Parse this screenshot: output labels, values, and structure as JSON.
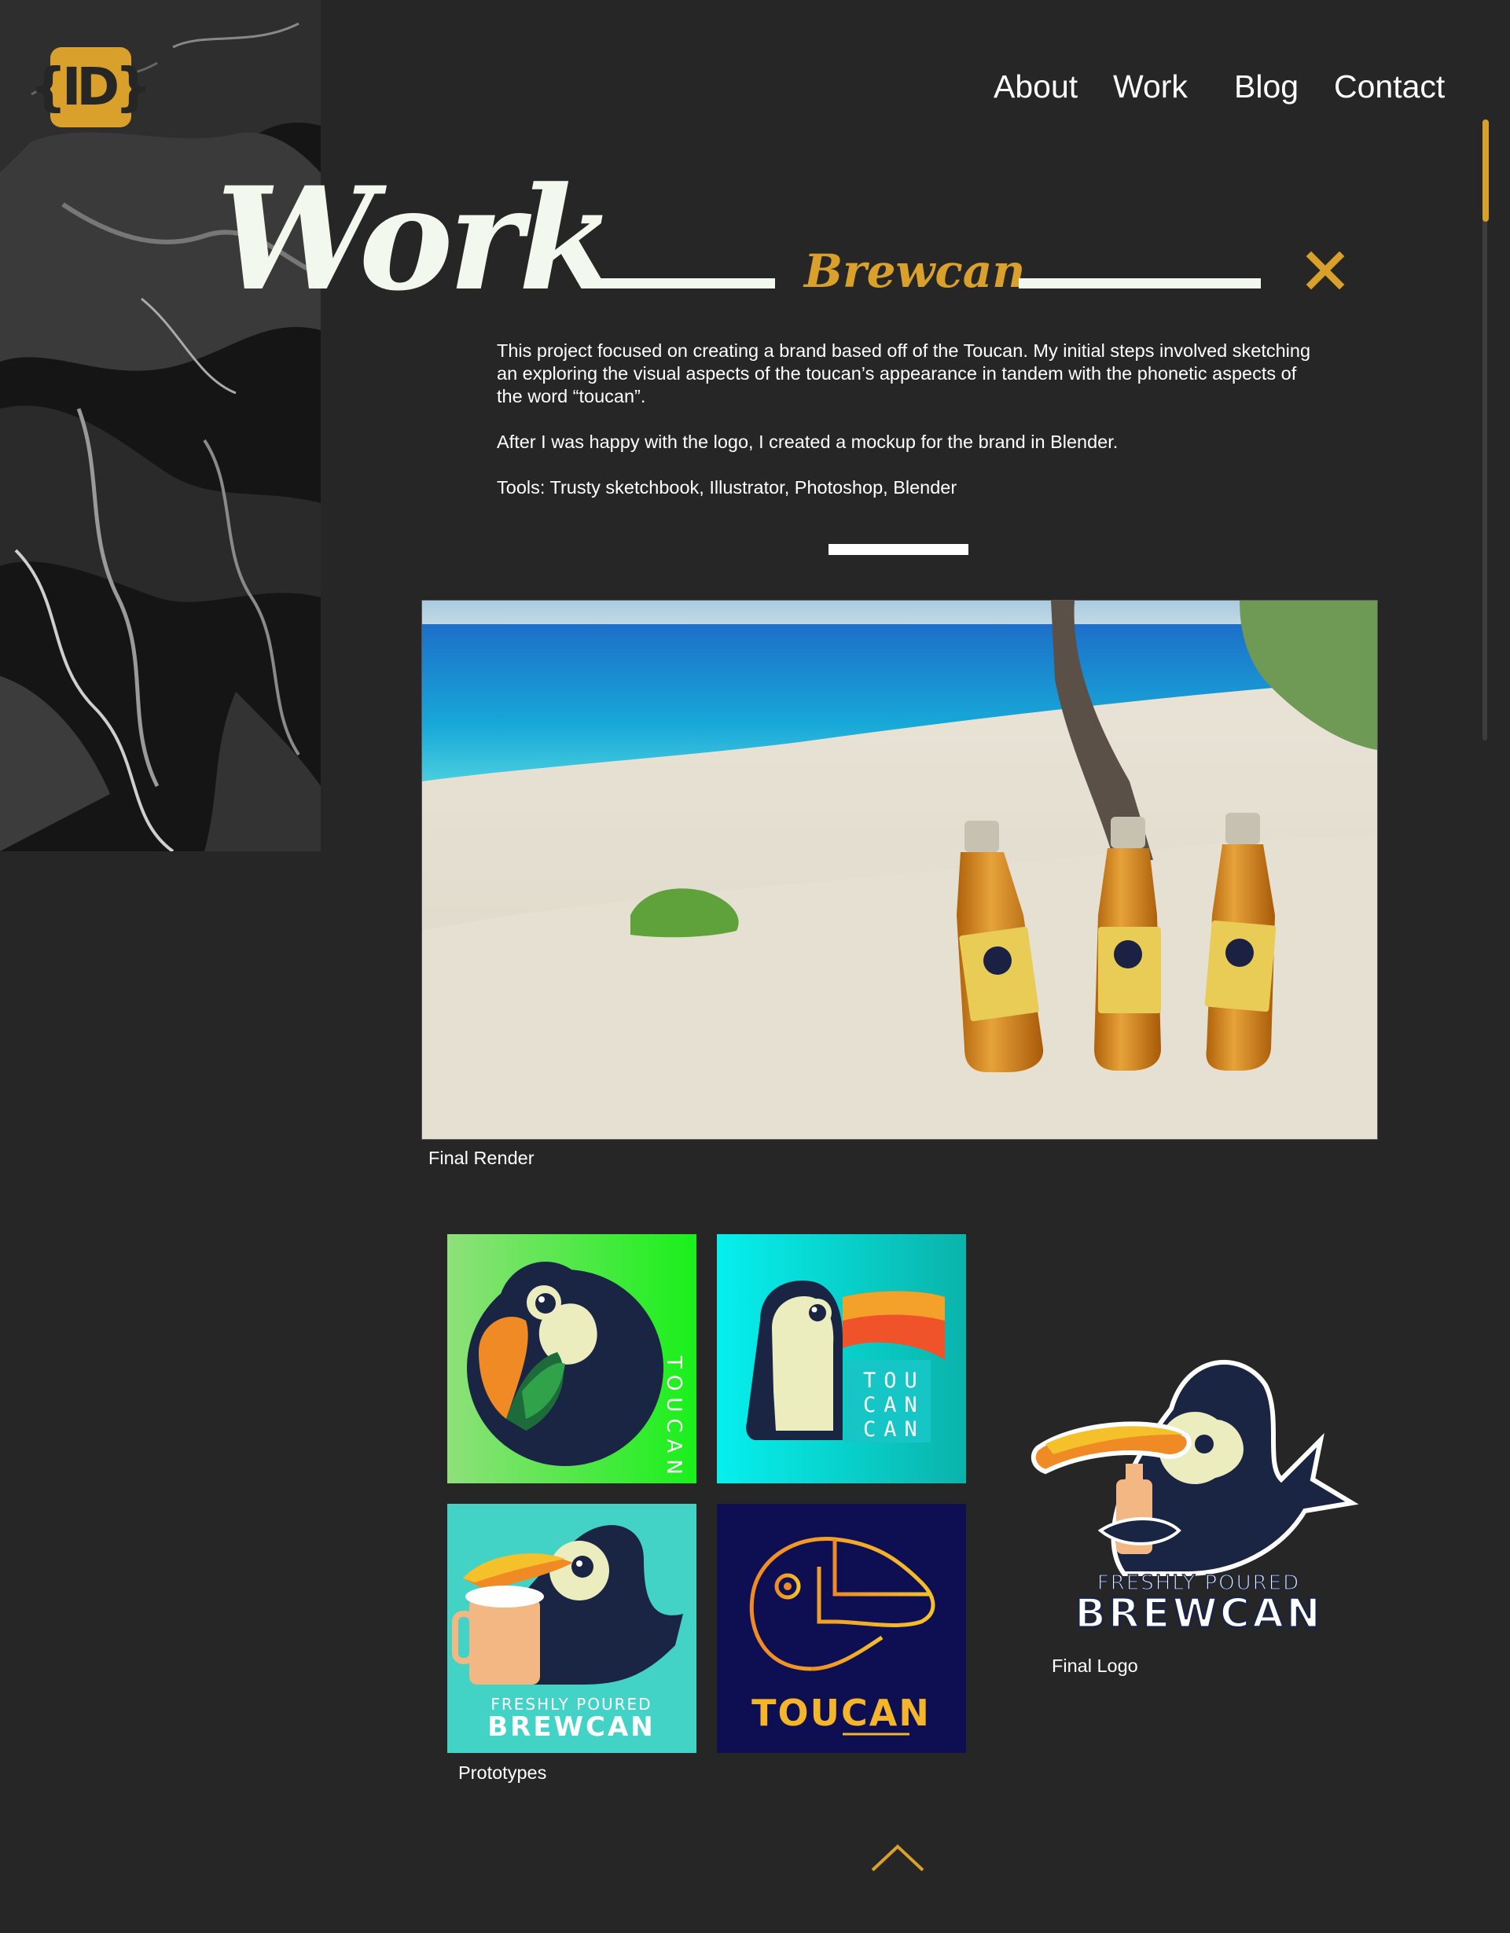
{
  "brand": {
    "logo_text": "{ID}",
    "accent": "#d9a02b"
  },
  "nav": {
    "about": "About",
    "work": "Work",
    "blog": "Blog",
    "contact": "Contact"
  },
  "header": {
    "title": "Work",
    "subtitle": "Brewcan",
    "close_icon": "close-icon"
  },
  "description": {
    "p1": "This project focused on creating a brand based off of the Toucan. My initial steps involved sketching an exploring the visual aspects of the toucan’s appearance in tandem with the phonetic aspects of the word “toucan”.",
    "p2": "After I was happy with the logo, I created a mockup for the brand in Blender.",
    "p3": "Tools: Trusty sketchbook, Illustrator, Photoshop, Blender"
  },
  "gallery": {
    "render_caption": "Final Render",
    "prototypes_caption": "Prototypes",
    "final_logo_caption": "Final Logo",
    "tile1_text": "TOUCAN",
    "tile2_lines": [
      "TOU",
      "CAN",
      "CAN"
    ],
    "tile3_small": "FRESHLY POURED",
    "tile3_big": "BREWCAN",
    "tile4_text": "TOUCAN",
    "final_small": "FRESHLY POURED",
    "final_big": "BREWCAN"
  },
  "footer": {
    "up_icon": "chevron-up-icon"
  }
}
